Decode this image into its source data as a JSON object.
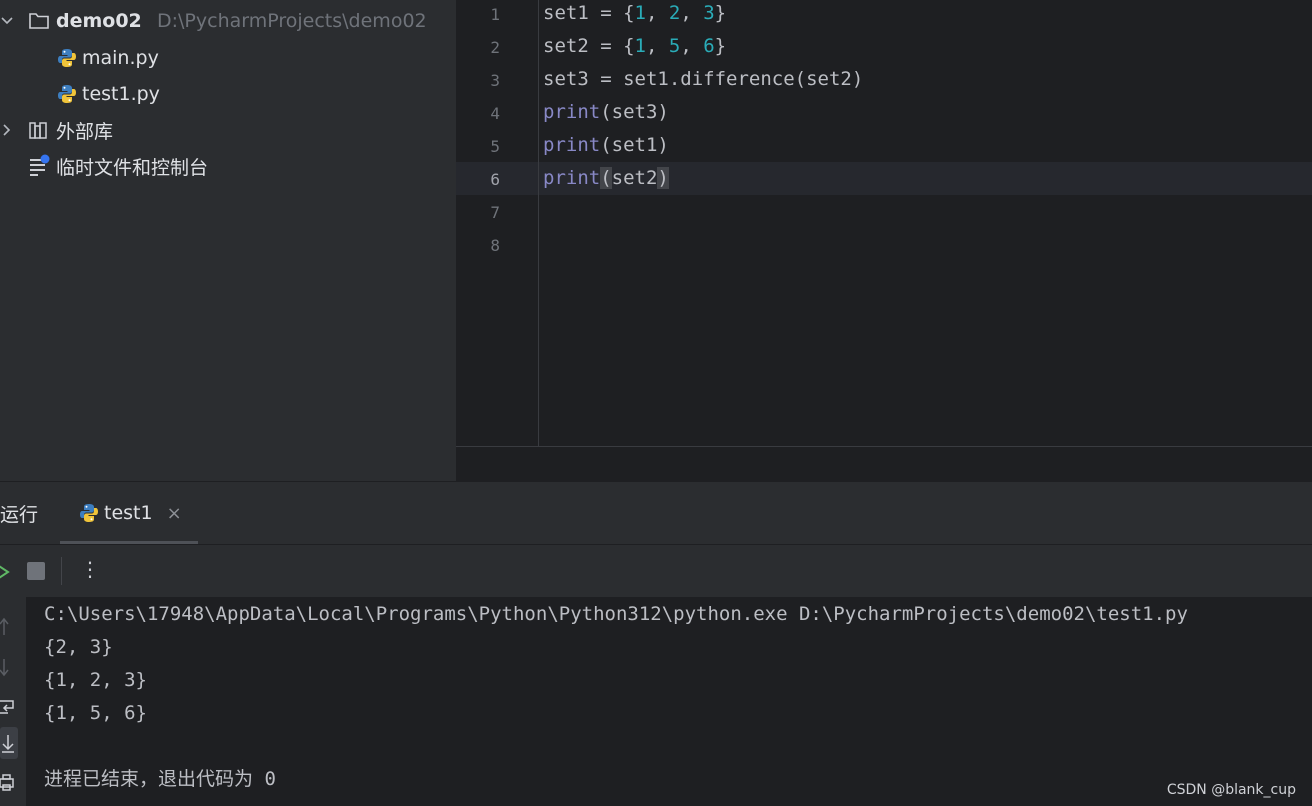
{
  "project": {
    "root_name": "demo02",
    "root_path": "D:\\PycharmProjects\\demo02",
    "files": [
      "main.py",
      "test1.py"
    ],
    "external_libs": "外部库",
    "scratches": "临时文件和控制台"
  },
  "editor": {
    "line_numbers": [
      "1",
      "2",
      "3",
      "4",
      "5",
      "6",
      "7",
      "8"
    ],
    "current_line": "6"
  },
  "run": {
    "title": "运行",
    "tab_label": "test1",
    "close_glyph": "×",
    "more_glyph": "⋮",
    "console": {
      "command": "C:\\Users\\17948\\AppData\\Local\\Programs\\Python\\Python312\\python.exe D:\\PycharmProjects\\demo02\\test1.py",
      "output": [
        "{2, 3}",
        "{1, 2, 3}",
        "{1, 5, 6}"
      ],
      "exit_message": "进程已结束，退出代码为 0"
    }
  },
  "watermark": "CSDN @blank_cup",
  "colors": {
    "background": "#2b2d30",
    "editor_bg": "#1e1f22",
    "number": "#2aacb8",
    "builtin": "#8888c6",
    "text": "#bcbec4"
  },
  "icons": [
    "chevron-down-icon",
    "folder-icon",
    "python-file-icon",
    "chevron-right-icon",
    "library-icon",
    "scratches-icon",
    "rerun-icon",
    "stop-icon",
    "more-icon",
    "scroll-up-icon",
    "scroll-down-icon",
    "soft-wrap-icon",
    "scroll-to-end-icon",
    "print-icon"
  ]
}
